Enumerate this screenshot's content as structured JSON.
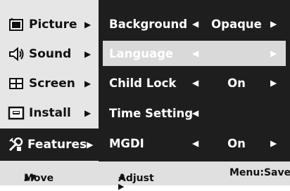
{
  "sidebar": {
    "items": [
      {
        "label": "Picture",
        "arrow": "▶",
        "icon": "picture-icon"
      },
      {
        "label": "Sound",
        "arrow": "▶",
        "icon": "sound-icon"
      },
      {
        "label": "Screen",
        "arrow": "▶",
        "icon": "screen-icon"
      },
      {
        "label": "Install",
        "arrow": "▶",
        "icon": "install-icon"
      },
      {
        "label": "Features",
        "arrow": "▶",
        "icon": "features-icon",
        "selected": true
      }
    ]
  },
  "panel": {
    "rows": [
      {
        "name": "Background",
        "left": "◀",
        "value": "Opaque",
        "right": "▶"
      },
      {
        "name": "Language",
        "left": "◀",
        "value": "",
        "right": "▶",
        "highlighted": true
      },
      {
        "name": "Child Lock",
        "left": "◀",
        "value": "On",
        "right": "▶"
      },
      {
        "name": "Time Setting",
        "left": "◀",
        "value": "",
        "right": ""
      },
      {
        "name": "MGDI",
        "left": "◀",
        "value": "On",
        "right": "▶"
      }
    ]
  },
  "footer": {
    "move_arrows": "▲▼",
    "move": "Move",
    "adjust_arrows": "◀ ▶",
    "adjust": "Adjust",
    "save": "Menu:Save"
  },
  "colors": {
    "panel_bg": "#1e1e1e",
    "sidebar_bg": "#e6e6e6",
    "highlight_bg": "#d9d9d9"
  }
}
